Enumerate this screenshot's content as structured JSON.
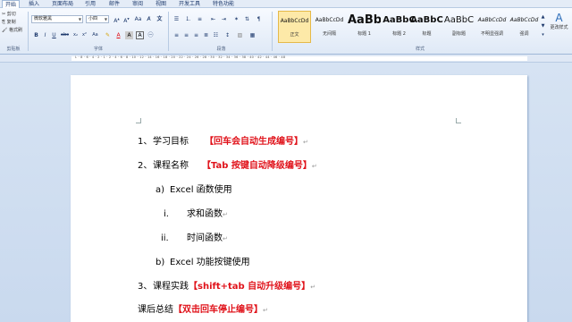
{
  "tabs": [
    "开始",
    "插入",
    "页面布局",
    "引用",
    "邮件",
    "审阅",
    "视图",
    "开发工具",
    "特色功能"
  ],
  "clipboard": {
    "cut": "剪切",
    "copy": "复制",
    "format_painter": "格式刷",
    "label": "剪贴板"
  },
  "font": {
    "name": "微软雅黑",
    "size": "小四",
    "label": "字体"
  },
  "paragraph_label": "段落",
  "styles": {
    "label": "样式",
    "items": [
      {
        "preview": "AaBbCcDd",
        "name": "正文"
      },
      {
        "preview": "AaBbCcDd",
        "name": "无间隔"
      },
      {
        "preview": "AaBb",
        "name": "标题 1"
      },
      {
        "preview": "AaBbC",
        "name": "标题 2"
      },
      {
        "preview": "AaBbC",
        "name": "标题"
      },
      {
        "preview": "AaBbC",
        "name": "副标题"
      },
      {
        "preview": "AaBbCcDd",
        "name": "不明显强调"
      },
      {
        "preview": "AaBbCcDd",
        "name": "强调"
      }
    ],
    "change_label": "更改样式"
  },
  "ruler": "L · 8 · 6 · 4 · 2 · 1 · 2 · 4 · 6 · 8 · 10 · 12 · 14 · 16 · 18 · 20 · 22 · 24 · 26 · 28 · 30 · 32 · 34 · 36 · 38 · 40 · 42 · 44 · 46 · 48",
  "colors": {
    "accent": "#e0121a",
    "ribbon": "#dfe9f6",
    "workspace": "#c9d9ee"
  },
  "document": [
    {
      "num": "1、",
      "text": "学习目标",
      "note": "【回车会自动生成编号】"
    },
    {
      "num": "2、",
      "text": "课程名称",
      "note": "【Tab 按键自动降级编号】"
    },
    {
      "num": "a)",
      "text": "Excel 函数使用",
      "note": ""
    },
    {
      "num": "i.",
      "text": "求和函数",
      "note": ""
    },
    {
      "num": "ii.",
      "text": "时间函数",
      "note": ""
    },
    {
      "num": "b)",
      "text": "Excel 功能按键使用",
      "note": ""
    },
    {
      "num": "3、",
      "text": "课程实践",
      "note": "【shift+tab 自动升级编号】"
    },
    {
      "num": "",
      "text": "课后总结",
      "note": "【双击回车停止编号】"
    }
  ],
  "para_mark": "↵"
}
